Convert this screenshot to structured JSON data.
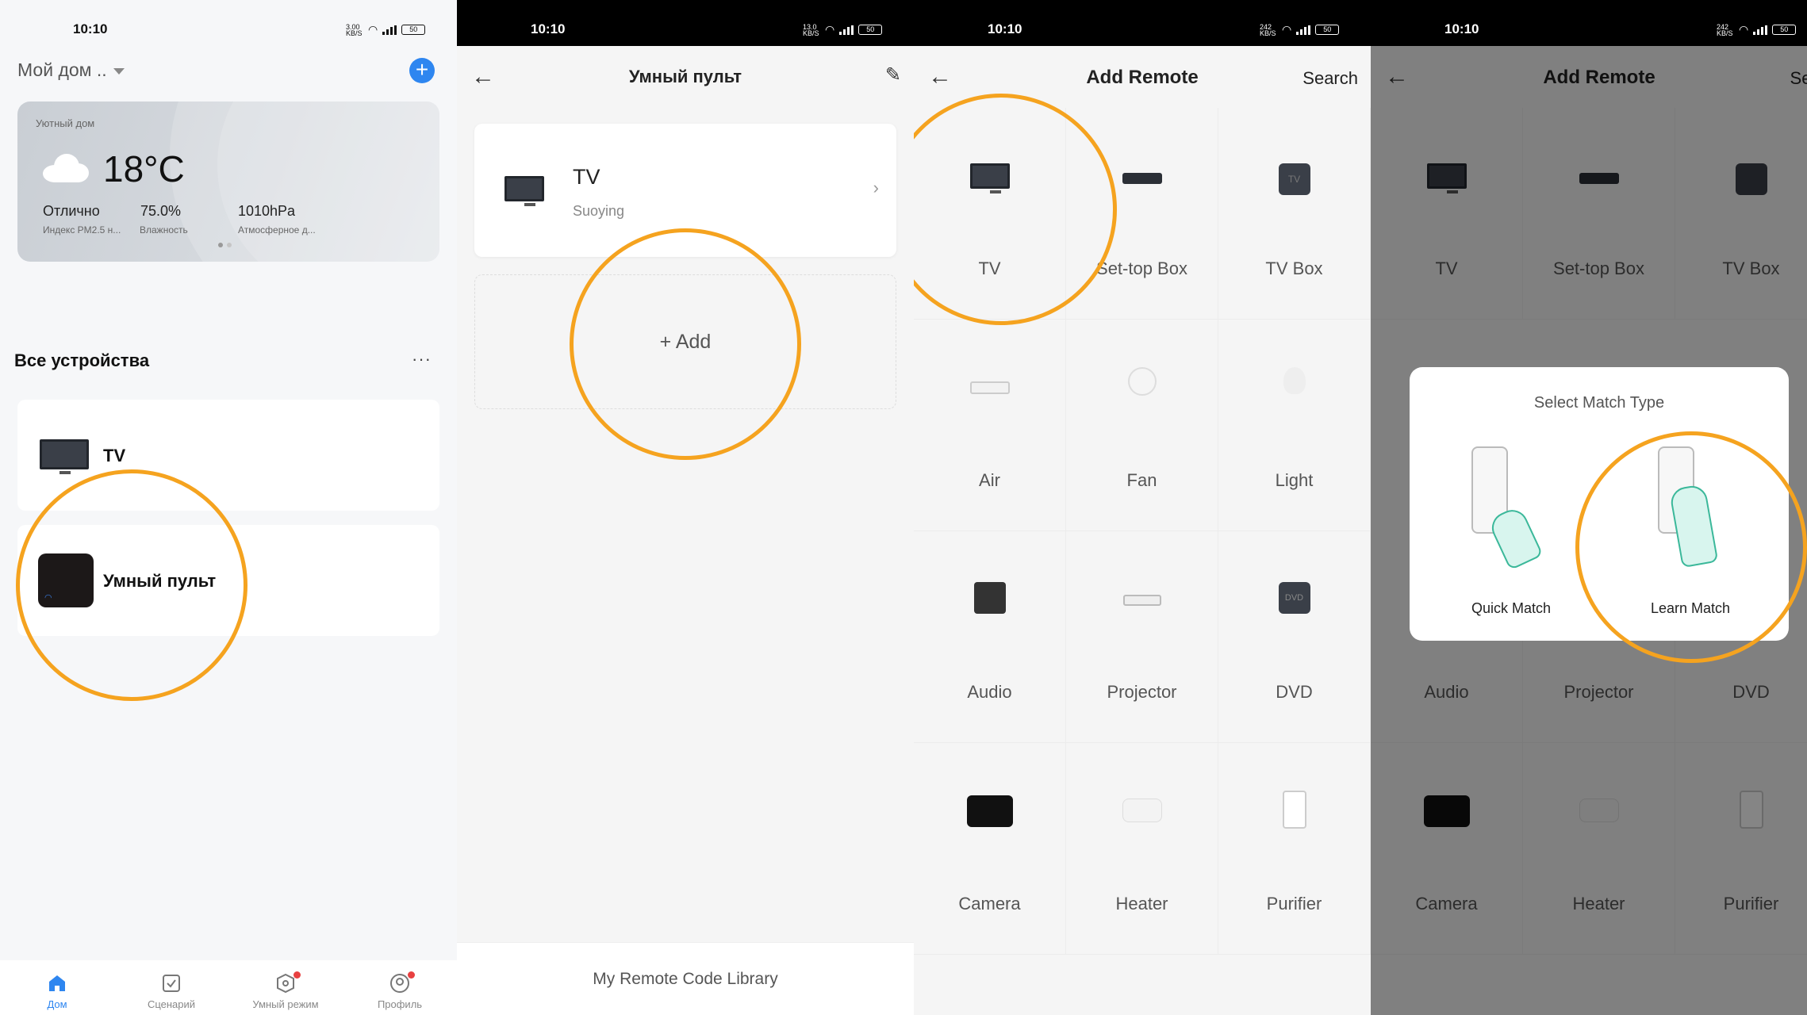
{
  "status": {
    "time": "10:10",
    "battery": "50",
    "speed": [
      "3.00 KB/S",
      "13.0 KB/S",
      "242 KB/S",
      "242 KB/S"
    ]
  },
  "screen1": {
    "home_title": "Мой дом ..",
    "weather": {
      "cozy": "Уютный дом",
      "temp": "18°C",
      "stat1": "Отлично",
      "stat2": "75.0%",
      "stat3": "1010hPa",
      "sub1": "Индекс PM2.5 н...",
      "sub2": "Влажность",
      "sub3": "Атмосферное д..."
    },
    "section_title": "Все устройства",
    "more": "···",
    "devices": [
      "TV",
      "Умный пульт"
    ],
    "tabs": [
      "Дом",
      "Сценарий",
      "Умный режим",
      "Профиль"
    ],
    "accent": "#2e86f0"
  },
  "screen2": {
    "title": "Умный пульт",
    "tv_name": "TV",
    "tv_brand": "Suoying",
    "add": "+ Add",
    "footer": "My Remote Code Library"
  },
  "screen3": {
    "title": "Add Remote",
    "search": "Search",
    "categories": [
      "TV",
      "Set-top Box",
      "TV Box",
      "Air",
      "Fan",
      "Light",
      "Audio",
      "Projector",
      "DVD",
      "Camera",
      "Heater",
      "Purifier"
    ]
  },
  "screen4": {
    "title": "Add Remote",
    "search": "Searc",
    "modal_title": "Select Match Type",
    "quick": "Quick Match",
    "learn": "Learn Match"
  },
  "highlight_color": "#f5a31f"
}
